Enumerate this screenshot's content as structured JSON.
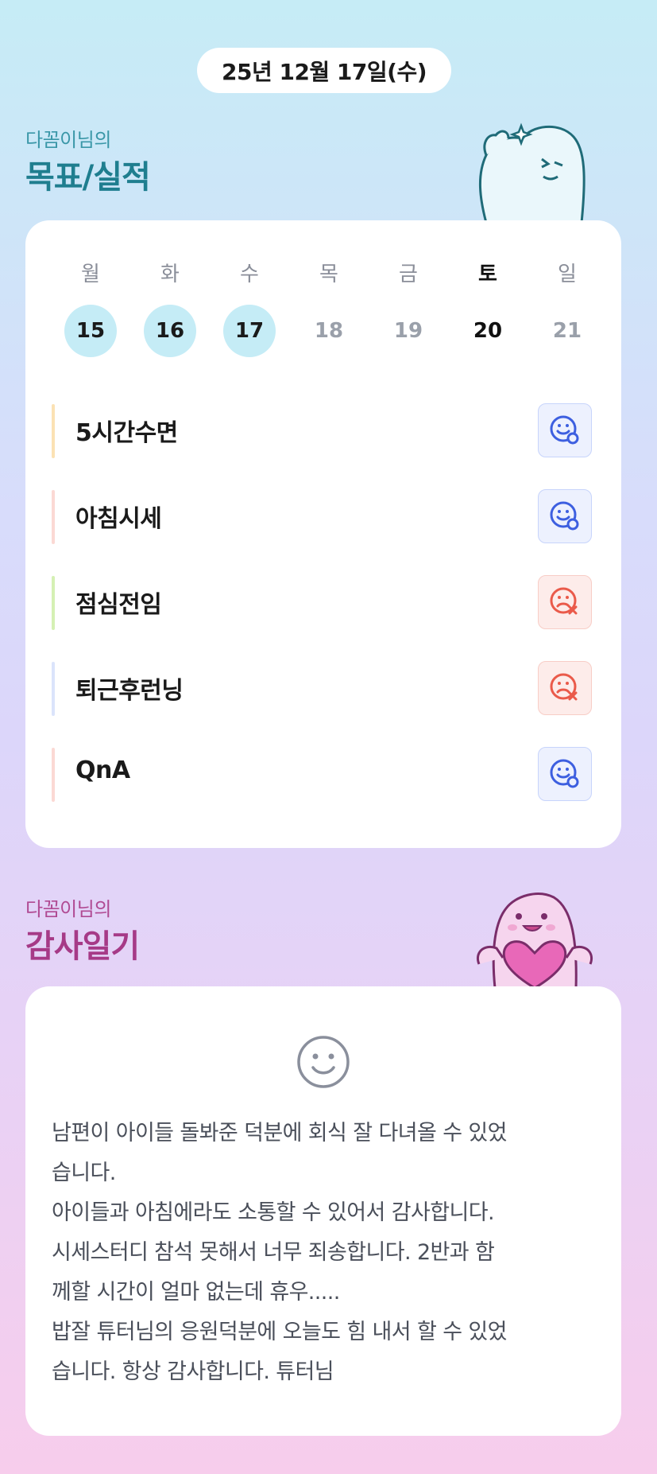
{
  "date": "25년 12월 17일(수)",
  "goal_section": {
    "subtitle": "다꼼이님의",
    "title": "목표/실적"
  },
  "week": [
    {
      "day": "월",
      "num": "15",
      "done": true,
      "bold": false
    },
    {
      "day": "화",
      "num": "16",
      "done": true,
      "bold": false
    },
    {
      "day": "수",
      "num": "17",
      "done": true,
      "bold": false
    },
    {
      "day": "목",
      "num": "18",
      "done": false,
      "bold": false
    },
    {
      "day": "금",
      "num": "19",
      "done": false,
      "bold": false
    },
    {
      "day": "토",
      "num": "20",
      "done": false,
      "bold": true
    },
    {
      "day": "일",
      "num": "21",
      "done": false,
      "bold": false
    }
  ],
  "goals": [
    {
      "label": "5시간수면",
      "bar_color": "#fbe2b4",
      "status": "success"
    },
    {
      "label": "아침시세",
      "bar_color": "#fbd9d4",
      "status": "success"
    },
    {
      "label": "점심전임",
      "bar_color": "#d5f0b4",
      "status": "fail"
    },
    {
      "label": "퇴근후런닝",
      "bar_color": "#dbe4fb",
      "status": "fail"
    },
    {
      "label": "QnA",
      "bar_color": "#fbd9d4",
      "status": "success"
    }
  ],
  "gratitude_section": {
    "subtitle": "다꼼이님의",
    "title": "감사일기"
  },
  "gratitude": {
    "mood_icon": "smile-icon",
    "text": "남편이 아이들 돌봐준 덕분에 회식 잘 다녀올 수 있었\n습니다.\n아이들과 아침에라도 소통할 수 있어서 감사합니다.\n시세스터디 참석 못해서 너무 죄송합니다. 2반과 함\n께할 시간이 얼마 없는데 휴우.....\n밥잘 튜터님의 응원덕분에 오늘도 힘 내서 할 수 있었\n습니다. 항상 감사합니다. 튜터님"
  },
  "colors": {
    "done_circle": "#c5ecf6",
    "success_icon": "#3d5fe0",
    "fail_icon": "#ea5a4a",
    "goal_title": "#1f7e8f",
    "gratitude_title": "#a63a87"
  }
}
